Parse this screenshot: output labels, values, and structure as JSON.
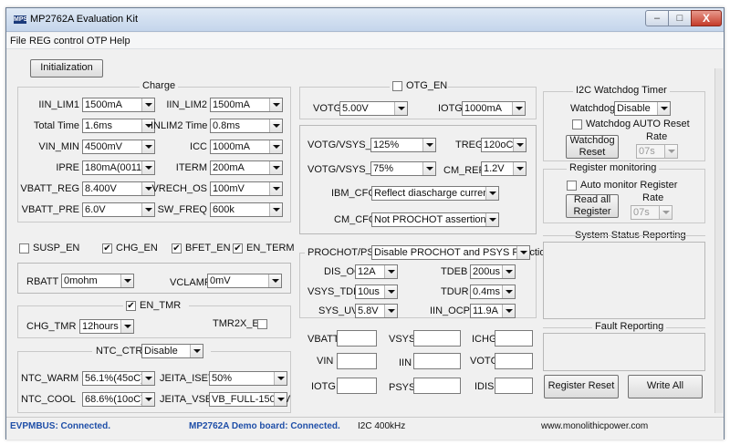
{
  "window": {
    "title": "MP2762A  Evaluation Kit",
    "app_icon_text": "MPS"
  },
  "caption_buttons": {
    "minimize": "–",
    "maximize": "□",
    "close": "X"
  },
  "menu": [
    "File",
    "REG control",
    "OTP",
    "Help"
  ],
  "init_button": "Initialization",
  "charge": {
    "title": "Charge",
    "iin_lim1": {
      "label": "IIN_LIM1",
      "value": "1500mA"
    },
    "iin_lim2": {
      "label": "IIN_LIM2",
      "value": "1500mA"
    },
    "total_time": {
      "label": "Total Time",
      "value": "1.6ms"
    },
    "inlim2_time": {
      "label": "INLIM2 Time",
      "value": "0.8ms"
    },
    "vin_min": {
      "label": "VIN_MIN",
      "value": "4500mV"
    },
    "icc": {
      "label": "ICC",
      "value": "1000mA"
    },
    "ipre": {
      "label": "IPRE",
      "value": "180mA(0011)"
    },
    "iterm": {
      "label": "ITERM",
      "value": "200mA"
    },
    "vbatt_reg": {
      "label": "VBATT_REG",
      "value": "8.400V"
    },
    "vrech_os": {
      "label": "VRECH_OS",
      "value": "100mV"
    },
    "vbatt_pre": {
      "label": "VBATT_PRE",
      "value": "6.0V"
    },
    "sw_freq": {
      "label": "SW_FREQ",
      "value": "600k"
    }
  },
  "checks": {
    "susp_en": {
      "label": "SUSP_EN",
      "checked": false
    },
    "chg_en": {
      "label": "CHG_EN",
      "checked": true
    },
    "bfet_en": {
      "label": "BFET_EN",
      "checked": true
    },
    "en_term": {
      "label": "EN_TERM",
      "checked": true
    }
  },
  "rbatt": {
    "label": "RBATT",
    "value": "0mohm"
  },
  "vclamp": {
    "label": "VCLAMP",
    "value": "0mV"
  },
  "tmr": {
    "en_tmr": {
      "label": "EN_TMR",
      "checked": true
    },
    "chg_tmr": {
      "label": "CHG_TMR",
      "value": "12hours"
    },
    "tmr2x_en": {
      "label": "TMR2X_EN",
      "checked": false
    }
  },
  "ntc": {
    "ctrl": {
      "label": "NTC_CTRL",
      "value": "Disable"
    },
    "warm": {
      "label": "NTC_WARM",
      "value": "56.1%(45oC)"
    },
    "jeita_iset": {
      "label": "JEITA_ISET",
      "value": "50%"
    },
    "cool": {
      "label": "NTC_COOL",
      "value": "68.6%(10oC)"
    },
    "jeita_vset": {
      "label": "JEITA_VSET",
      "value": "VB_FULL-150mV"
    }
  },
  "otg": {
    "otg_en": {
      "label": "OTG_EN",
      "checked": false
    },
    "votg": {
      "label": "VOTG",
      "value": "5.00V"
    },
    "iotg": {
      "label": "IOTG",
      "value": "1000mA"
    }
  },
  "vsys_panel": {
    "votg_vsys_ov": {
      "label": "VOTG/VSYS_OV",
      "value": "125%"
    },
    "treg": {
      "label": "TREG",
      "value": "120oC"
    },
    "votg_vsys_uv": {
      "label": "VOTG/VSYS_UV",
      "value": "75%"
    },
    "cm_ref": {
      "label": "CM_REF",
      "value": "1.2V"
    },
    "ibm_cfg": {
      "label": "IBM_CFG",
      "value": "Reflect diascharge current"
    },
    "cm_cfg": {
      "label": "CM_CFG",
      "value": "Not PROCHOT assertion"
    }
  },
  "prochot": {
    "label": "PROCHOT/PSYS",
    "value": "Disable PROCHOT and PSYS Function",
    "dis_oc": {
      "label": "DIS_OC",
      "value": "12A"
    },
    "tdeb": {
      "label": "TDEB",
      "value": "200us"
    },
    "vsys_tdb": {
      "label": "VSYS_TDB",
      "value": "10us"
    },
    "tdur": {
      "label": "TDUR",
      "value": "0.4ms"
    },
    "sys_uv": {
      "label": "SYS_UV",
      "value": "5.8V"
    },
    "iin_ocp": {
      "label": "IIN_OCP",
      "value": "11.9A"
    }
  },
  "readouts": {
    "vbatt": {
      "label": "VBATT",
      "value": ""
    },
    "vsys": {
      "label": "VSYS",
      "value": ""
    },
    "ichg": {
      "label": "ICHG",
      "value": ""
    },
    "vin": {
      "label": "VIN",
      "value": ""
    },
    "iin": {
      "label": "IIN",
      "value": ""
    },
    "votg": {
      "label": "VOTG",
      "value": ""
    },
    "iotg": {
      "label": "IOTG",
      "value": ""
    },
    "psys": {
      "label": "PSYS",
      "value": ""
    },
    "idis": {
      "label": "IDIS",
      "value": ""
    }
  },
  "watchdog": {
    "title": "I2C Watchdog Timer",
    "label": "Watchdog",
    "value": "Disable",
    "auto_reset": {
      "label": "Watchdog AUTO Reset",
      "checked": false
    },
    "reset_button": "Watchdog Reset",
    "rate_label": "Rate",
    "rate_value": "07s"
  },
  "reg_monitor": {
    "title": "Register monitoring",
    "auto_monitor": {
      "label": "Auto monitor Register",
      "checked": false
    },
    "read_all_button": "Read all Register",
    "rate_label": "Rate",
    "rate_value": "07s"
  },
  "system_status": {
    "title": "System Status Reporting"
  },
  "fault": {
    "title": "Fault Reporting"
  },
  "buttons": {
    "register_reset": "Register Reset",
    "write_all": "Write All"
  },
  "status": {
    "evpmbus": "EVPMBUS: Connected.",
    "board": "MP2762A Demo board: Connected.",
    "i2c": "I2C 400kHz",
    "url": "www.monolithicpower.com"
  },
  "colors": {
    "status_blue": "#1f4fa8",
    "titlebar": "#c4d5eb"
  }
}
